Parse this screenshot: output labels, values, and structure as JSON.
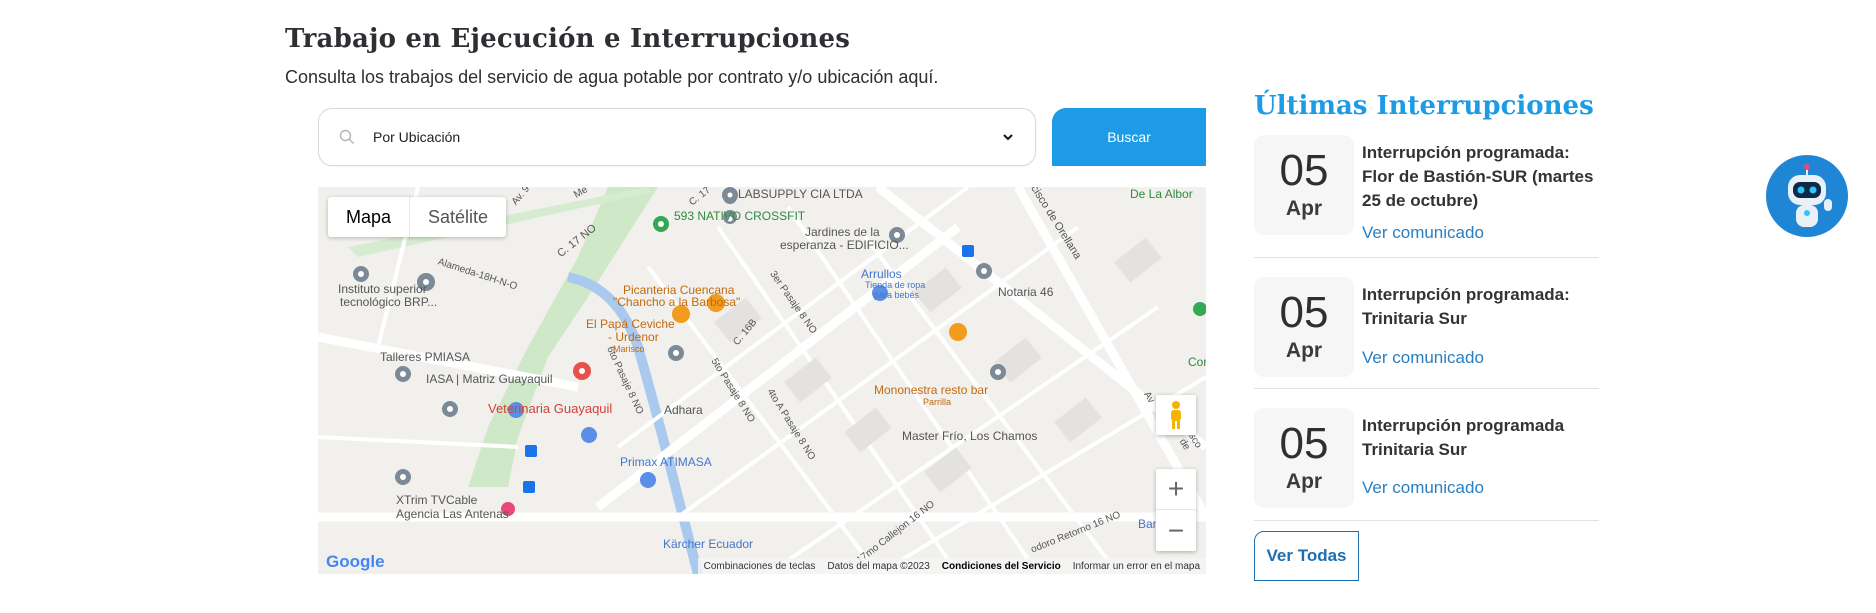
{
  "header": {
    "title": "Trabajo en Ejecución e Interrupciones",
    "subtitle": "Consulta los trabajos del servicio de agua potable por contrato y/o ubicación aquí."
  },
  "search": {
    "selected_value": "Por Ubicación",
    "button_label": "Buscar"
  },
  "map": {
    "type_tabs": [
      "Mapa",
      "Satélite"
    ],
    "labels": [
      "LABSUPPLY CIA LTDA",
      "593 NATIVO CROSSFIT",
      "Jardines de la",
      "esperanza - EDIFICIO...",
      "Instituto superior",
      "tecnológico BRP...",
      "Alameda-18H-N-O",
      "C. 17 NO",
      "C. 17",
      "Arrullos",
      "Tienda de ropa",
      "para bebés",
      "Notaria 46",
      "Picanteria Cuencana",
      "\"Chancho a la Barbosa\"",
      "El Papá Ceviche",
      "- Urdenor",
      "Marisco",
      "C. 16B",
      "3er Pasaje 8 NO",
      "Talleres PMIASA",
      "IASA | Matriz Guayaquil",
      "6to Pasaje 8 NO",
      "5to Pasaje 8 NO",
      "4to A Pasaje 8 NO",
      "Adhara",
      "Mononestra resto bar",
      "Parrilla",
      "Veterinaria Guayaquil",
      "Master Frío, Los Chamos",
      "Primax ATIMASA",
      "XTrim TVCable",
      "Agencia Las Antenas",
      "Kärcher Ecuador",
      "17mo Callejon 16 NO",
      "odoro Retorno 16 NO",
      "Banco B",
      "ancisco de Orellana",
      "De La Albor",
      "Cor",
      "Av. 9",
      "Me",
      "Av",
      "sco de"
    ],
    "attribution": {
      "shortcuts": "Combinaciones de teclas",
      "data": "Datos del mapa ©2023",
      "terms": "Condiciones del Servicio",
      "report": "Informar un error en el mapa"
    },
    "logo": "Google",
    "zoom_in": "+",
    "zoom_out": "−"
  },
  "sidebar": {
    "title": "Últimas Interrupciones",
    "items": [
      {
        "day": "05",
        "month": "Apr",
        "title": "Interrupción programada: Flor de Bastión-SUR (martes 25 de octubre)",
        "link": "Ver comunicado"
      },
      {
        "day": "05",
        "month": "Apr",
        "title": "Interrupción programada: Trinitaria Sur",
        "link": "Ver comunicado"
      },
      {
        "day": "05",
        "month": "Apr",
        "title": "Interrupción programada Trinitaria Sur",
        "link": "Ver comunicado"
      }
    ],
    "all_button": "Ver Todas"
  },
  "colors": {
    "accent": "#1d9be6",
    "link": "#2a7fc1",
    "title_dark": "#2f2f33"
  },
  "icons": [
    "search-icon",
    "chevron-down-icon",
    "pegman-icon",
    "robot-assistant-icon"
  ]
}
